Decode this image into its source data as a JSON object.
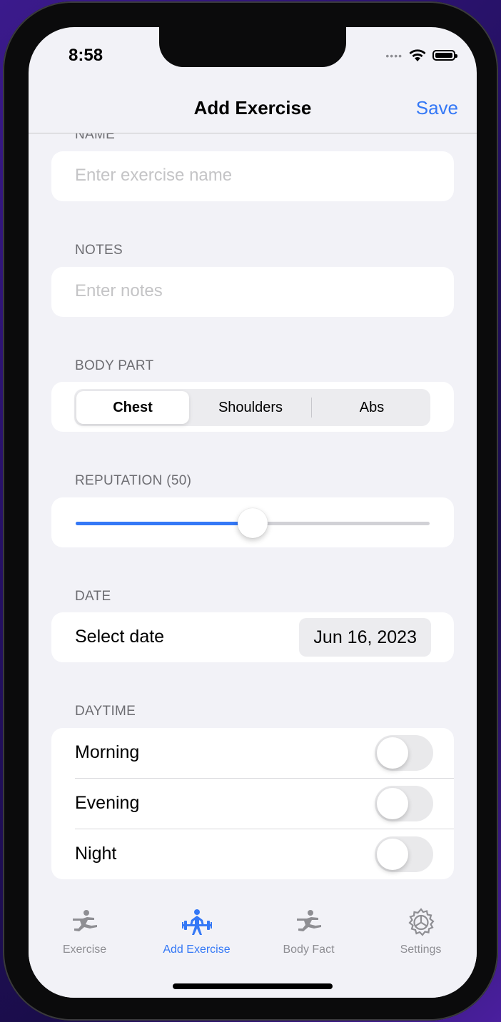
{
  "status": {
    "time": "8:58"
  },
  "nav": {
    "title": "Add Exercise",
    "save_label": "Save"
  },
  "sections": {
    "name": {
      "header": "NAME",
      "placeholder": "Enter exercise name"
    },
    "notes": {
      "header": "NOTES",
      "placeholder": "Enter notes"
    },
    "body_part": {
      "header": "BODY PART",
      "options": [
        "Chest",
        "Shoulders",
        "Abs"
      ],
      "selected": "Chest"
    },
    "reputation": {
      "header": "REPUTATION (50)",
      "value": 50,
      "min": 0,
      "max": 100
    },
    "date": {
      "header": "DATE",
      "label": "Select date",
      "value": "Jun 16, 2023"
    },
    "daytime": {
      "header": "DAYTIME",
      "items": [
        {
          "label": "Morning",
          "on": false
        },
        {
          "label": "Evening",
          "on": false
        },
        {
          "label": "Night",
          "on": false
        }
      ]
    }
  },
  "tabs": [
    {
      "label": "Exercise",
      "icon": "exercise-icon",
      "active": false
    },
    {
      "label": "Add Exercise",
      "icon": "weightlifter-icon",
      "active": true
    },
    {
      "label": "Body Fact",
      "icon": "exercise-icon",
      "active": false
    },
    {
      "label": "Settings",
      "icon": "gear-icon",
      "active": false
    }
  ],
  "colors": {
    "accent": "#3478f6",
    "inactive": "#8e8e93",
    "background": "#f2f2f7"
  }
}
